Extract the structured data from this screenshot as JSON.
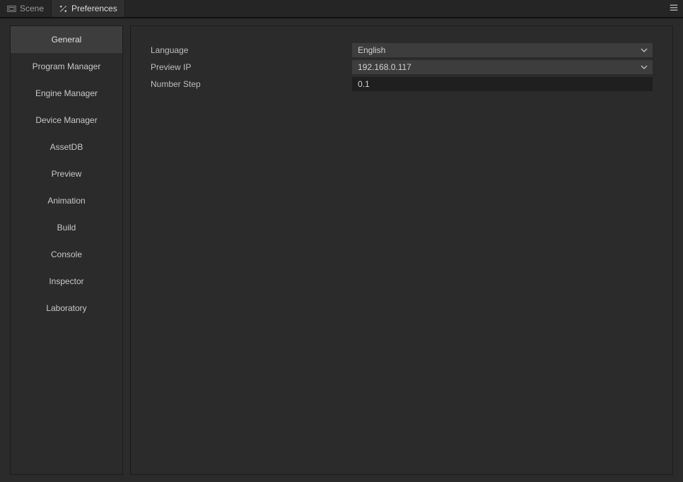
{
  "tabs": {
    "scene": {
      "label": "Scene"
    },
    "preferences": {
      "label": "Preferences"
    }
  },
  "sidebar": {
    "items": [
      {
        "label": "General"
      },
      {
        "label": "Program Manager"
      },
      {
        "label": "Engine Manager"
      },
      {
        "label": "Device Manager"
      },
      {
        "label": "AssetDB"
      },
      {
        "label": "Preview"
      },
      {
        "label": "Animation"
      },
      {
        "label": "Build"
      },
      {
        "label": "Console"
      },
      {
        "label": "Inspector"
      },
      {
        "label": "Laboratory"
      }
    ],
    "active_index": 0
  },
  "settings": {
    "language": {
      "label": "Language",
      "value": "English"
    },
    "preview_ip": {
      "label": "Preview IP",
      "value": "192.168.0.117"
    },
    "number_step": {
      "label": "Number Step",
      "value": "0.1"
    }
  }
}
